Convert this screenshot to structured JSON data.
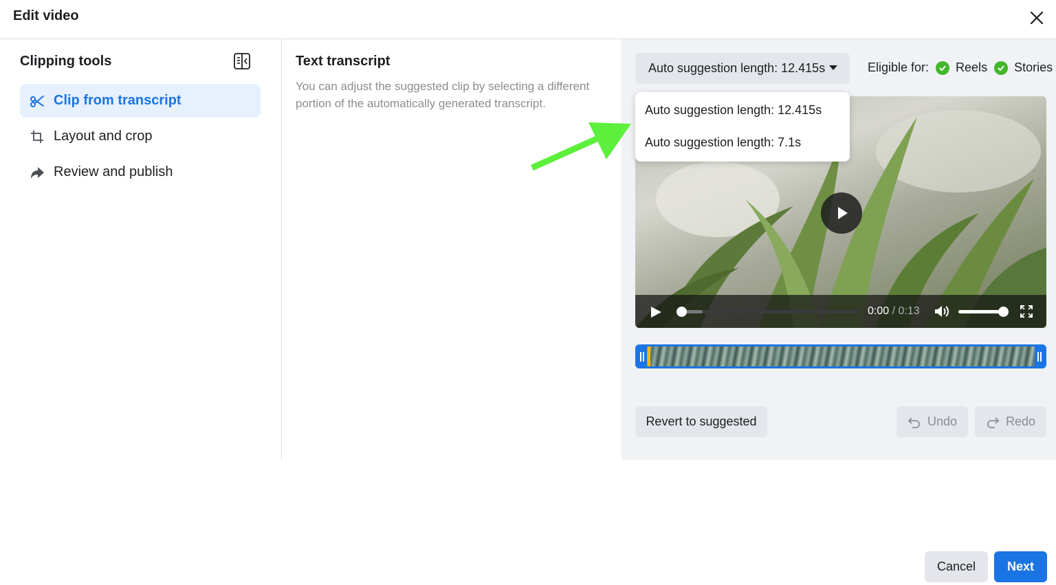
{
  "header": {
    "title": "Edit video"
  },
  "left_panel": {
    "title": "Clipping tools",
    "items": [
      {
        "label": "Clip from transcript",
        "icon": "scissors-icon",
        "active": true
      },
      {
        "label": "Layout and crop",
        "icon": "crop-icon",
        "active": false
      },
      {
        "label": "Review and publish",
        "icon": "share-arrow-icon",
        "active": false
      }
    ]
  },
  "transcript": {
    "title": "Text transcript",
    "description": "You can adjust the suggested clip by selecting a different portion of the automatically generated transcript."
  },
  "editor": {
    "dropdown_label": "Auto suggestion length: 12.415s",
    "dropdown_options": [
      "Auto suggestion length: 12.415s",
      "Auto suggestion length: 7.1s"
    ],
    "eligible_label": "Eligible for:",
    "eligible_targets": [
      "Reels",
      "Stories"
    ],
    "player": {
      "current_time": "0:00",
      "separator": "/",
      "duration": "0:13",
      "progress": 0.0,
      "volume": 1.0
    },
    "revert_label": "Revert to suggested",
    "undo_label": "Undo",
    "redo_label": "Redo"
  },
  "footer": {
    "cancel_label": "Cancel",
    "next_label": "Next"
  },
  "colors": {
    "accent": "#1b74e4",
    "check": "#42b72a",
    "annotation_arrow": "#5cf03c",
    "playhead": "#f5b800"
  }
}
